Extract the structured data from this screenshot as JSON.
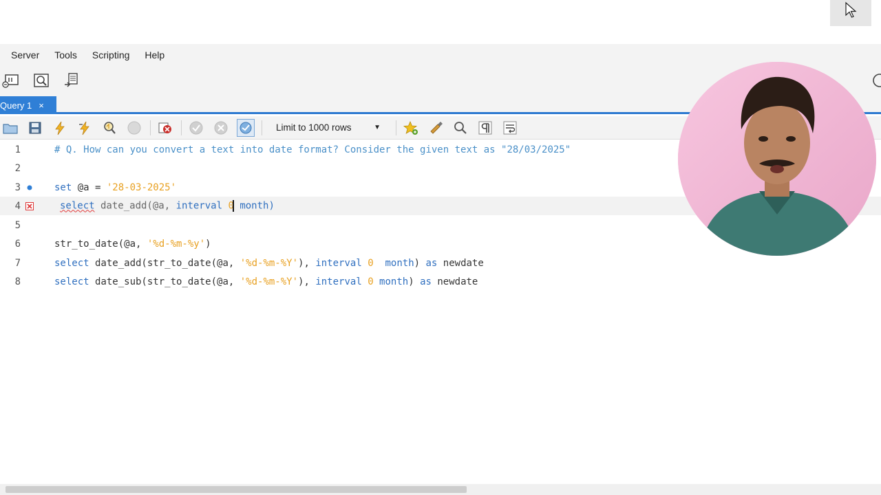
{
  "menu": {
    "items": [
      "Server",
      "Tools",
      "Scripting",
      "Help"
    ]
  },
  "tab": {
    "label": "Query 1",
    "close": "×"
  },
  "query_toolbar": {
    "limit_label": "Limit to 1000 rows"
  },
  "editor": {
    "lines": [
      {
        "n": "1"
      },
      {
        "n": "2"
      },
      {
        "n": "3"
      },
      {
        "n": "4"
      },
      {
        "n": "5"
      },
      {
        "n": "6"
      },
      {
        "n": "7"
      },
      {
        "n": "8"
      }
    ],
    "tokens": {
      "l1_comment": "# Q. How can you convert a text into date format? Consider the given text as \"28/03/2025\"",
      "l3_set": "set",
      "l3_var": " @a = ",
      "l3_str": "'28-03-2025'",
      "l4_select": "select",
      "l4_fn": " date_add(@a, ",
      "l4_interval": "interval",
      "l4_num": " 0",
      "l4_rest": " month)",
      "l6_fn": "str_to_date(@a, ",
      "l6_str": "'%d-%m-%y'",
      "l6_close": ")",
      "l7_select": "select",
      "l7_fn": " date_add(str_to_date(@a, ",
      "l7_str": "'%d-%m-%Y'",
      "l7_mid": "), ",
      "l7_interval": "interval",
      "l7_num": " 0",
      "l7_month": "  month",
      "l7_close": ") ",
      "l7_as": "as",
      "l7_alias": " newdate",
      "l8_select": "select",
      "l8_fn": " date_sub(str_to_date(@a, ",
      "l8_str": "'%d-%m-%Y'",
      "l8_mid": "), ",
      "l8_interval": "interval",
      "l8_num": " 0",
      "l8_month": " month",
      "l8_close": ") ",
      "l8_as": "as",
      "l8_alias": " newdate"
    }
  },
  "colors": {
    "accent": "#2f7fd6",
    "keyword": "#2f6fbf",
    "string": "#e8a020",
    "comment": "#4a90c8",
    "error": "#e23b3b"
  },
  "icons": {
    "top_toolbar": [
      "new-connection-icon",
      "inspect-icon",
      "manage-server-icon"
    ],
    "query_toolbar": [
      "open-folder-icon",
      "save-icon",
      "execute-icon",
      "execute-current-icon",
      "explain-icon",
      "stop-icon",
      "toggle-error-icon",
      "commit-icon",
      "rollback-icon",
      "autocommit-icon",
      "bookmark-star-icon",
      "beautify-icon",
      "find-icon",
      "invisible-chars-icon",
      "wrap-icon"
    ]
  }
}
